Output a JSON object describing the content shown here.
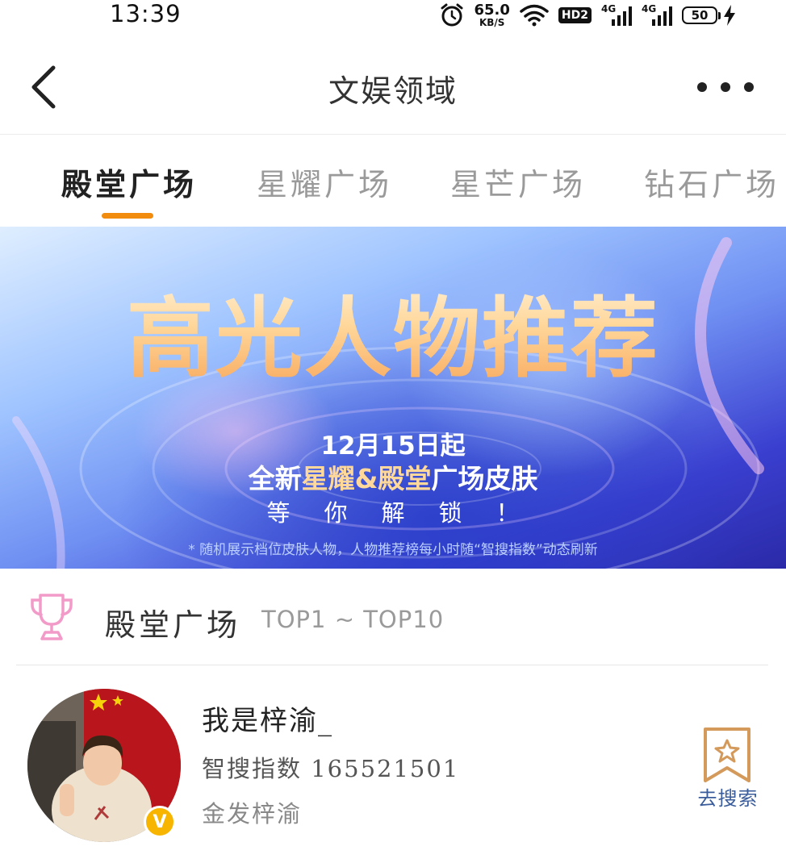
{
  "status_bar": {
    "time": "13:39",
    "net_speed_value": "65.0",
    "net_speed_unit": "KB/S",
    "hd_badge": "HD2",
    "signal1_label": "4G",
    "signal2_label": "4G",
    "battery_level": "50",
    "icons": [
      "alarm-icon",
      "wifi-icon",
      "hd-icon",
      "signal-icon",
      "signal-icon",
      "battery-icon",
      "charging-icon"
    ]
  },
  "nav": {
    "title": "文娱领域",
    "back_icon": "chevron-left-icon",
    "more_icon": "more-dots-icon"
  },
  "tabs": [
    {
      "label": "殿堂广场",
      "active": true
    },
    {
      "label": "星耀广场",
      "active": false
    },
    {
      "label": "星芒广场",
      "active": false
    },
    {
      "label": "钻石广场",
      "active": false
    }
  ],
  "banner": {
    "title": "高光人物推荐",
    "date": "12月15日起",
    "subtitle_prefix": "全新",
    "subtitle_highlight": "星耀&殿堂",
    "subtitle_suffix": "广场皮肤",
    "cta": "等你解锁！",
    "note": "* 随机展示档位皮肤人物，人物推荐榜每小时随“智搜指数”动态刷新"
  },
  "section": {
    "title": "殿堂广场",
    "range": "TOP1 ~ TOP10",
    "icon": "trophy-icon"
  },
  "list": [
    {
      "name": "我是梓渝_",
      "search_index": "智搜指数 165521501",
      "description": "金发梓渝",
      "badge": "V",
      "action_label": "去搜索",
      "action_icon": "bookmark-star-icon"
    }
  ],
  "colors": {
    "accent": "#f28c0f",
    "trophy": "#f29bc9",
    "action": "#3a5c9a",
    "bookmark": "#d39a5b"
  }
}
